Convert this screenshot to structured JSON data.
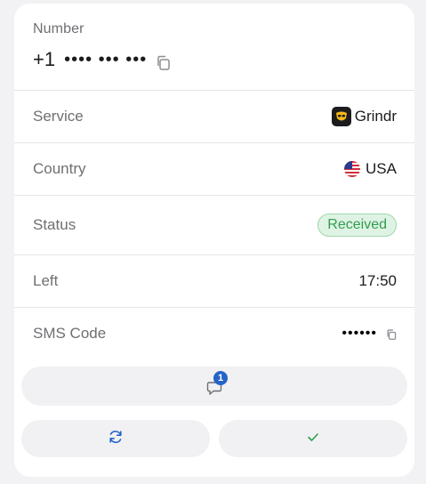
{
  "number": {
    "label": "Number",
    "prefix": "+1",
    "masked": "•••• ••• •••"
  },
  "rows": {
    "service": {
      "label": "Service",
      "value": "Grindr",
      "icon": "grindr-icon"
    },
    "country": {
      "label": "Country",
      "value": "USA",
      "icon": "us-flag-icon"
    },
    "status": {
      "label": "Status",
      "value": "Received",
      "color": "#2f9e4f"
    },
    "left": {
      "label": "Left",
      "value": "17:50"
    },
    "sms_code": {
      "label": "SMS Code",
      "value": "••••••"
    }
  },
  "actions": {
    "messages_count": "1",
    "messages_icon": "chat-bubble-icon",
    "refresh_icon": "refresh-icon",
    "confirm_icon": "check-icon"
  },
  "colors": {
    "accent": "#2563c9",
    "success": "#2f9e4f",
    "service_brand": "#f5b81c"
  }
}
